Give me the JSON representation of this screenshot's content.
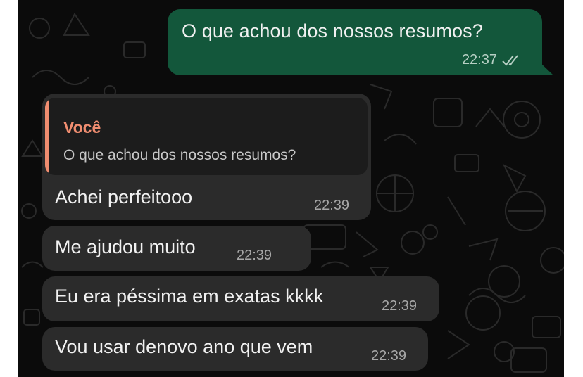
{
  "colors": {
    "outgoing_bubble": "#13573b",
    "incoming_bubble": "#2b2b2b",
    "quote_accent": "#f08d70",
    "background": "#0b0b0b"
  },
  "messages": {
    "outgoing": {
      "text": "O que achou dos nossos resumos?",
      "time": "22:37",
      "status_icon": "double-check-icon"
    },
    "reply": {
      "quote_author": "Você",
      "quote_text": "O que achou dos nossos resumos?",
      "text": "Achei perfeitooo",
      "time": "22:39"
    },
    "incoming": [
      {
        "text": "Me ajudou muito",
        "time": "22:39"
      },
      {
        "text": "Eu era péssima em exatas kkkk",
        "time": "22:39"
      },
      {
        "text": "Vou usar denovo ano que vem",
        "time": "22:39"
      }
    ]
  }
}
